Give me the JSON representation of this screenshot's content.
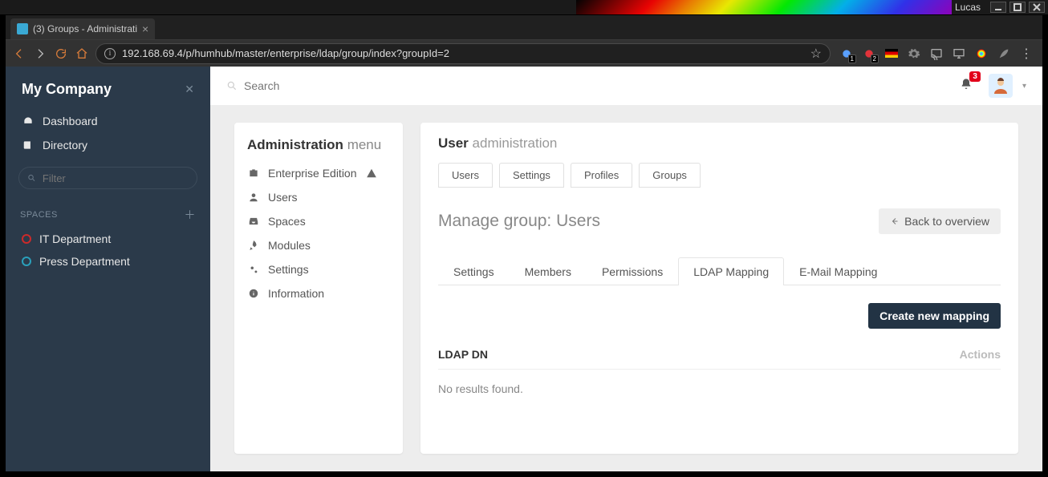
{
  "os": {
    "user": "Lucas"
  },
  "browser": {
    "tab_title": "(3) Groups - Administrati",
    "url": "192.168.69.4/p/humhub/master/enterprise/ldap/group/index?groupId=2",
    "ext_badge1": "1",
    "ext_badge2": "2"
  },
  "sidebar": {
    "brand": "My Company",
    "nav": [
      {
        "label": "Dashboard",
        "icon": "dashboard"
      },
      {
        "label": "Directory",
        "icon": "book"
      }
    ],
    "filter_placeholder": "Filter",
    "spaces_heading": "SPACES",
    "spaces": [
      {
        "label": "IT Department",
        "color": "#cc2a2a"
      },
      {
        "label": "Press Department",
        "color": "#2aa0bb"
      }
    ]
  },
  "topbar": {
    "search_placeholder": "Search",
    "notifications_badge": "3"
  },
  "admin_menu": {
    "title_bold": "Administration",
    "title_light": "menu",
    "items": [
      {
        "label": "Enterprise Edition",
        "icon": "briefcase",
        "warn": true
      },
      {
        "label": "Users",
        "icon": "user"
      },
      {
        "label": "Spaces",
        "icon": "inbox"
      },
      {
        "label": "Modules",
        "icon": "rocket"
      },
      {
        "label": "Settings",
        "icon": "gears"
      },
      {
        "label": "Information",
        "icon": "info"
      }
    ]
  },
  "main": {
    "title_bold": "User",
    "title_light": "administration",
    "tabs": [
      "Users",
      "Settings",
      "Profiles",
      "Groups"
    ],
    "section_title": "Manage group: Users",
    "back_button": "Back to overview",
    "subtabs": [
      "Settings",
      "Members",
      "Permissions",
      "LDAP Mapping",
      "E-Mail Mapping"
    ],
    "active_subtab": "LDAP Mapping",
    "create_button": "Create new mapping",
    "table": {
      "col_dn": "LDAP DN",
      "col_actions": "Actions",
      "empty": "No results found."
    }
  }
}
